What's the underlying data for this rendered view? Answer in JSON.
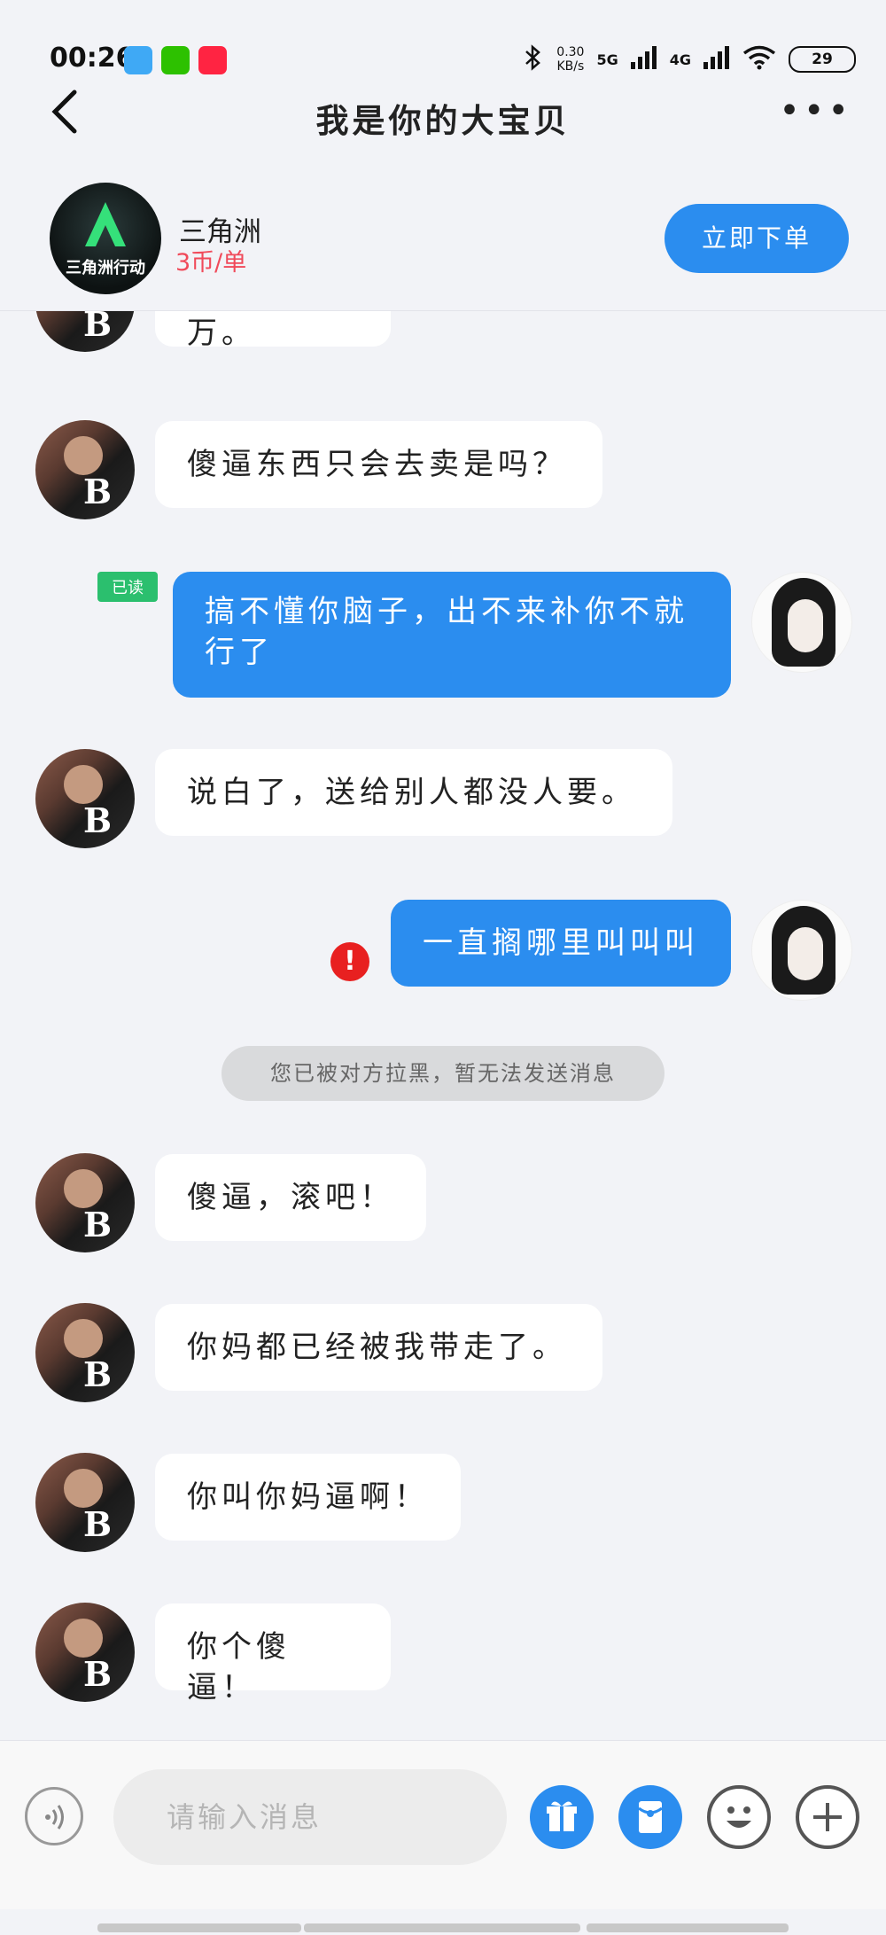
{
  "status_bar": {
    "time": "00:26",
    "net_speed_value": "0.30",
    "net_speed_unit": "KB/s",
    "signal_1": "5G",
    "signal_2": "4G",
    "battery": "29",
    "app_icons": [
      "weibo-icon",
      "wechat-icon",
      "xiaohongshu-icon"
    ]
  },
  "header": {
    "title": "我是你的大宝贝"
  },
  "shop": {
    "name": "三角洲",
    "price": "3币/单",
    "logo_text": "三角洲行动",
    "order_button": "立即下单"
  },
  "messages": [
    {
      "side": "left",
      "text": "你个八万。"
    },
    {
      "side": "left",
      "text": "傻逼东西只会去卖是吗？"
    },
    {
      "side": "right",
      "text": "搞不懂你脑子，出不来补你不就行了",
      "read_label": "已读"
    },
    {
      "side": "left",
      "text": "说白了，送给别人都没人要。"
    },
    {
      "side": "right",
      "text": "一直搁哪里叫叫叫",
      "failed": true
    },
    {
      "side": "left",
      "text": "傻逼，滚吧！"
    },
    {
      "side": "left",
      "text": "你妈都已经被我带走了。"
    },
    {
      "side": "left",
      "text": "你叫你妈逼啊！"
    },
    {
      "side": "left",
      "text": "你个傻逼！"
    }
  ],
  "system_tip": "您已被对方拉黑，暂无法发送消息",
  "input": {
    "placeholder": "请输入消息",
    "value": ""
  },
  "colors": {
    "accent": "#2b8def",
    "price": "#f04a5a",
    "read_tag": "#2bbf6e",
    "error": "#e82020",
    "background": "#f2f3f7"
  }
}
